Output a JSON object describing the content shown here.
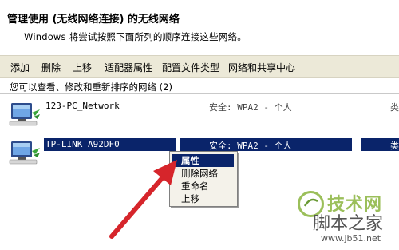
{
  "header": {
    "title": "管理使用 (无线网络连接) 的无线网络",
    "subtitle": "Windows 将尝试按照下面所列的顺序连接这些网络。"
  },
  "toolbar": {
    "buttons": [
      {
        "label": "添加"
      },
      {
        "label": "删除"
      },
      {
        "label": "上移"
      },
      {
        "label": "适配器属性"
      },
      {
        "label": "配置文件类型"
      },
      {
        "label": "网络和共享中心"
      }
    ]
  },
  "section": {
    "header": "您可以查看、修改和重新排序的网络 (2)"
  },
  "networks": [
    {
      "name": "123-PC_Network",
      "security": "安全: WPA2 - 个人",
      "extra": "类",
      "selected": false,
      "icon": "wireless-network-icon"
    },
    {
      "name": "TP-LINK_A92DF0",
      "security": "安全: WPA2 - 个人",
      "extra": "类",
      "selected": true,
      "icon": "wireless-network-icon"
    }
  ],
  "context_menu": {
    "items": [
      {
        "label": "属性",
        "highlighted": true
      },
      {
        "label": "删除网络",
        "highlighted": false
      },
      {
        "label": "重命名",
        "highlighted": false
      },
      {
        "label": "上移",
        "highlighted": false
      }
    ]
  },
  "watermark": {
    "brand": "技术网",
    "site_name": "脚本之家",
    "url": "www.jb51.net"
  },
  "colors": {
    "toolbar_bg": "#ece9d8",
    "selection": "#0a246a",
    "arrow": "#d6252b"
  }
}
